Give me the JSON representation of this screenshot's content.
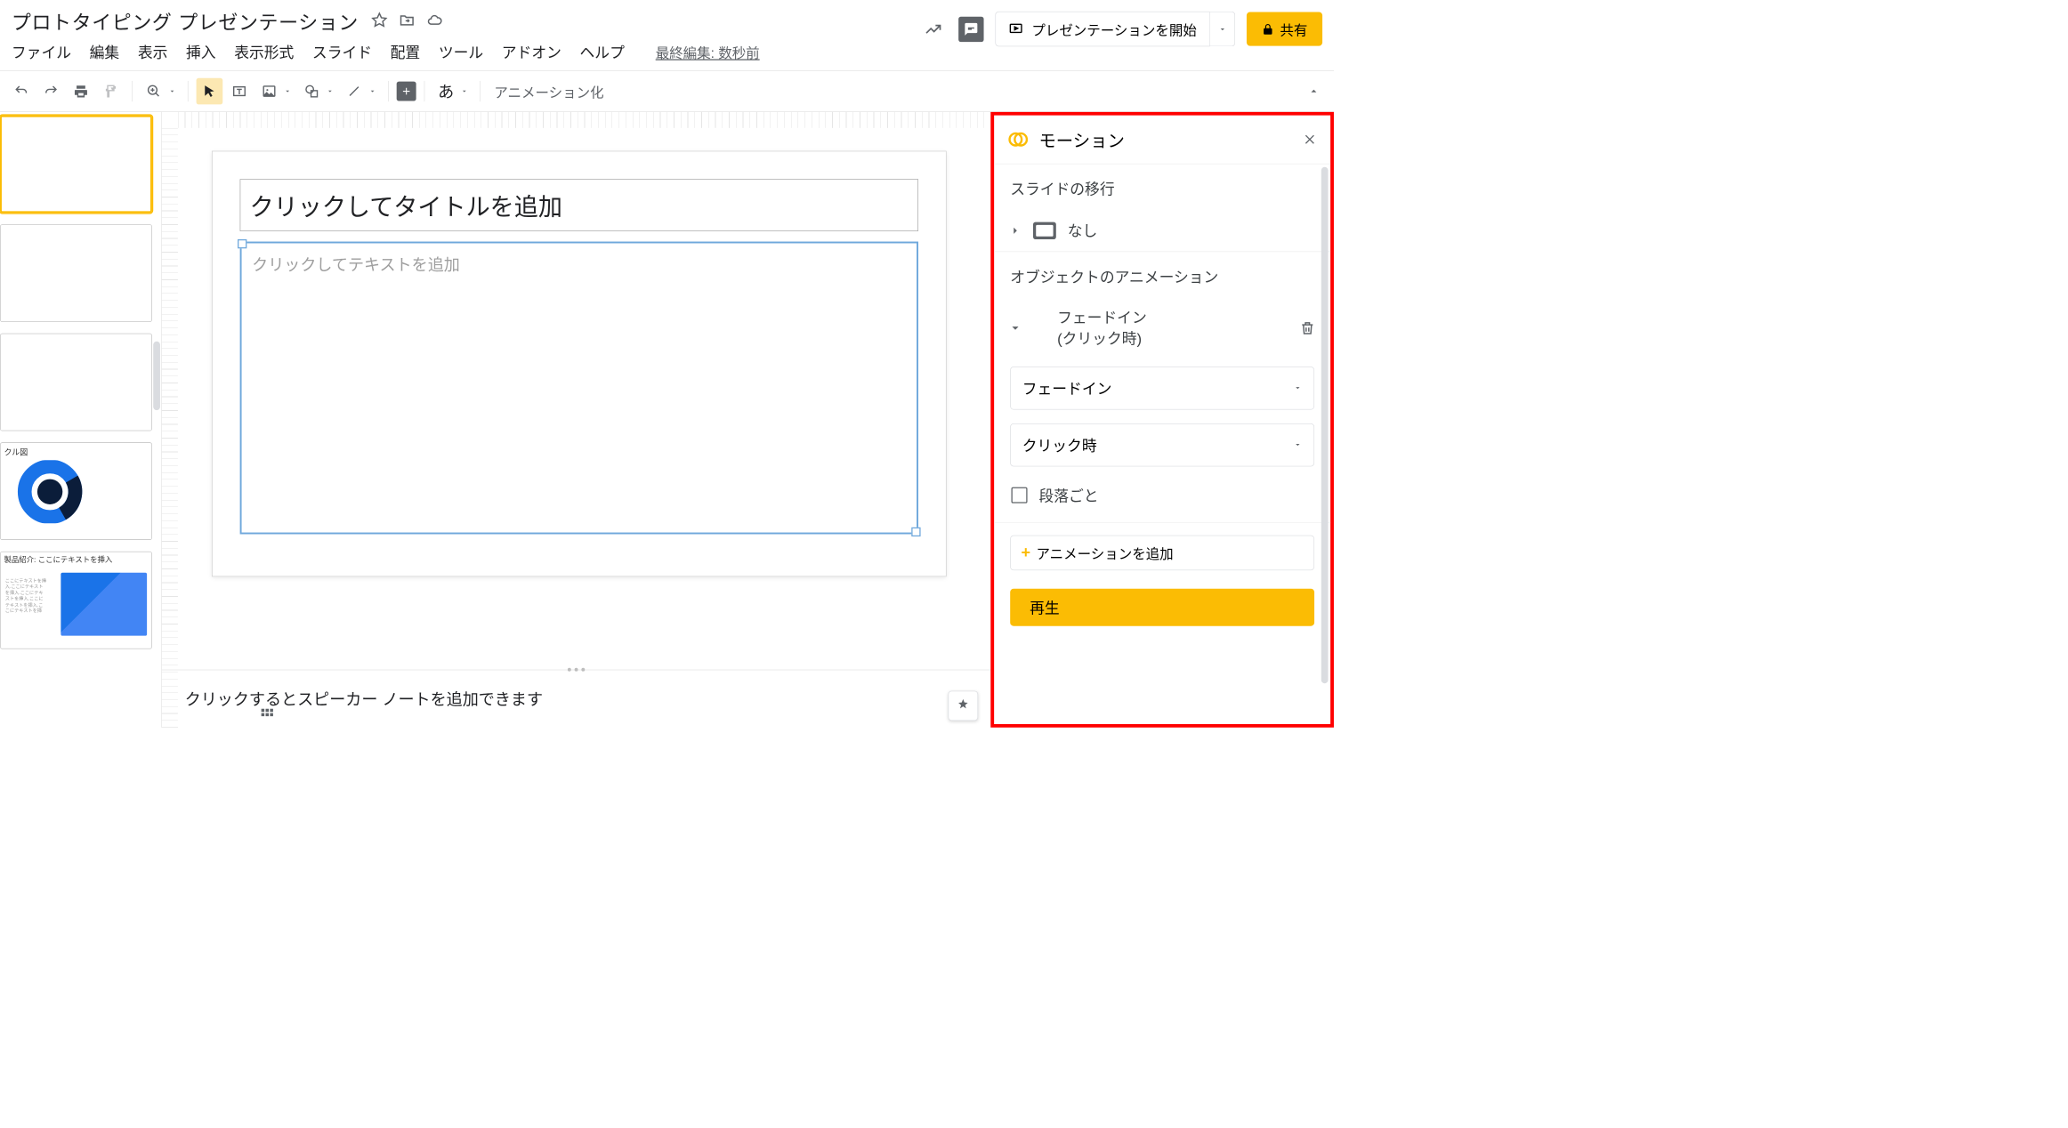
{
  "doc": {
    "title": "プロトタイピング プレゼンテーション"
  },
  "menu": {
    "items": [
      "ファイル",
      "編集",
      "表示",
      "挿入",
      "表示形式",
      "スライド",
      "配置",
      "ツール",
      "アドオン",
      "ヘルプ"
    ],
    "last_edit": "最終編集: 数秒前"
  },
  "header": {
    "present": "プレゼンテーションを開始",
    "share": "共有"
  },
  "toolbar": {
    "ime": "あ",
    "animation": "アニメーション化"
  },
  "slide": {
    "title_placeholder": "クリックしてタイトルを追加",
    "body_placeholder": "クリックしてテキストを追加"
  },
  "speaker": {
    "placeholder": "クリックするとスピーカー ノートを追加できます"
  },
  "thumbs": {
    "t4_title": "クル図",
    "t5_title": "製品紹介: ここにテキストを挿入"
  },
  "motion": {
    "title": "モーション",
    "transition_section": "スライドの移行",
    "transition_value": "なし",
    "object_section": "オブジェクトのアニメーション",
    "anim_name": "フェードイン",
    "anim_trigger": "(クリック時)",
    "select_type": "フェードイン",
    "select_when": "クリック時",
    "paragraph_check": "段落ごと",
    "add_button": "アニメーションを追加",
    "play": "再生"
  }
}
